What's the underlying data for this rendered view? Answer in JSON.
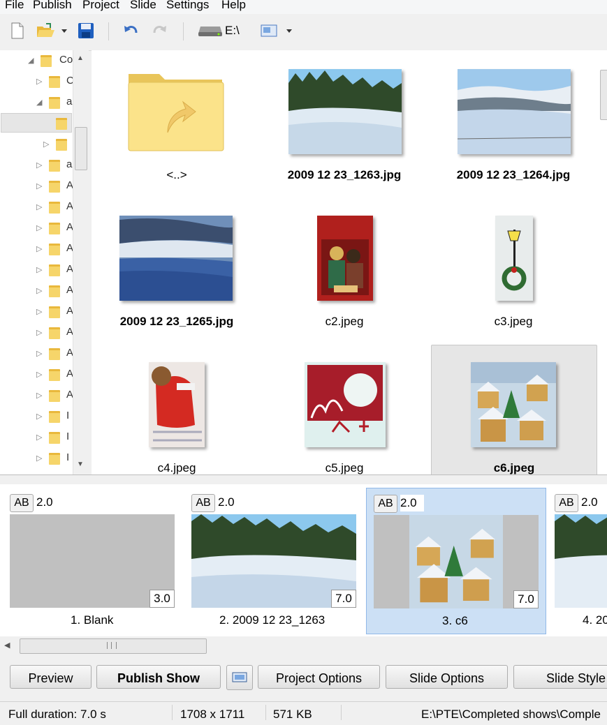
{
  "menu": [
    "File",
    "Publish",
    "Project",
    "Slide",
    "Settings",
    "Help"
  ],
  "toolbar": {
    "drive_label": "E:\\"
  },
  "tree": {
    "rows": [
      {
        "label": "Co",
        "arrow": "◢"
      },
      {
        "label": "C",
        "arrow": "▷"
      },
      {
        "label": "a",
        "arrow": "◢"
      },
      {
        "label": "",
        "arrow": ""
      },
      {
        "label": "",
        "arrow": "▷"
      },
      {
        "label": "a",
        "arrow": "▷"
      },
      {
        "label": "A",
        "arrow": "▷"
      },
      {
        "label": "A",
        "arrow": "▷"
      },
      {
        "label": "A",
        "arrow": "▷"
      },
      {
        "label": "A",
        "arrow": "▷"
      },
      {
        "label": "A",
        "arrow": "▷"
      },
      {
        "label": "A",
        "arrow": "▷"
      },
      {
        "label": "A",
        "arrow": "▷"
      },
      {
        "label": "A",
        "arrow": "▷"
      },
      {
        "label": "A",
        "arrow": "▷"
      },
      {
        "label": "A",
        "arrow": "▷"
      },
      {
        "label": "A",
        "arrow": "▷"
      },
      {
        "label": "I",
        "arrow": "▷"
      },
      {
        "label": "I",
        "arrow": "▷"
      },
      {
        "label": "I",
        "arrow": "▷"
      }
    ]
  },
  "files": [
    {
      "name": "<..>",
      "bold": false,
      "kind": "up"
    },
    {
      "name": "2009 12 23_1263.jpg",
      "bold": true,
      "kind": "forest"
    },
    {
      "name": "2009 12 23_1264.jpg",
      "bold": true,
      "kind": "hills"
    },
    {
      "name": "2009 12 23_1265.jpg",
      "bold": true,
      "kind": "sky"
    },
    {
      "name": "c2.jpeg",
      "bold": false,
      "kind": "card-red"
    },
    {
      "name": "c3.jpeg",
      "bold": false,
      "kind": "card-lamp"
    },
    {
      "name": "c4.jpeg",
      "bold": false,
      "kind": "card-santa"
    },
    {
      "name": "c5.jpeg",
      "bold": false,
      "kind": "card-swirl"
    },
    {
      "name": "c6.jpeg",
      "bold": true,
      "kind": "village",
      "selected": true
    }
  ],
  "slides": [
    {
      "ab": "AB",
      "transition": "2.0",
      "duration": "3.0",
      "name": "1. Blank",
      "kind": "blank"
    },
    {
      "ab": "AB",
      "transition": "2.0",
      "duration": "7.0",
      "name": "2. 2009 12 23_1263",
      "kind": "forest"
    },
    {
      "ab": "AB",
      "transition": "2.0",
      "duration": "7.0",
      "name": "3. c6",
      "kind": "village",
      "selected": true
    },
    {
      "ab": "AB",
      "transition": "2.0",
      "duration": "",
      "name": "4. 20",
      "kind": "forest"
    }
  ],
  "buttons": {
    "preview": "Preview",
    "publish": "Publish Show",
    "project_options": "Project Options",
    "slide_options": "Slide Options",
    "slide_style": "Slide Style"
  },
  "status": {
    "duration": "Full duration: 7.0 s",
    "dimensions": "1708 x 1711",
    "size": "571 KB",
    "path": "E:\\PTE\\Completed shows\\Comple"
  }
}
